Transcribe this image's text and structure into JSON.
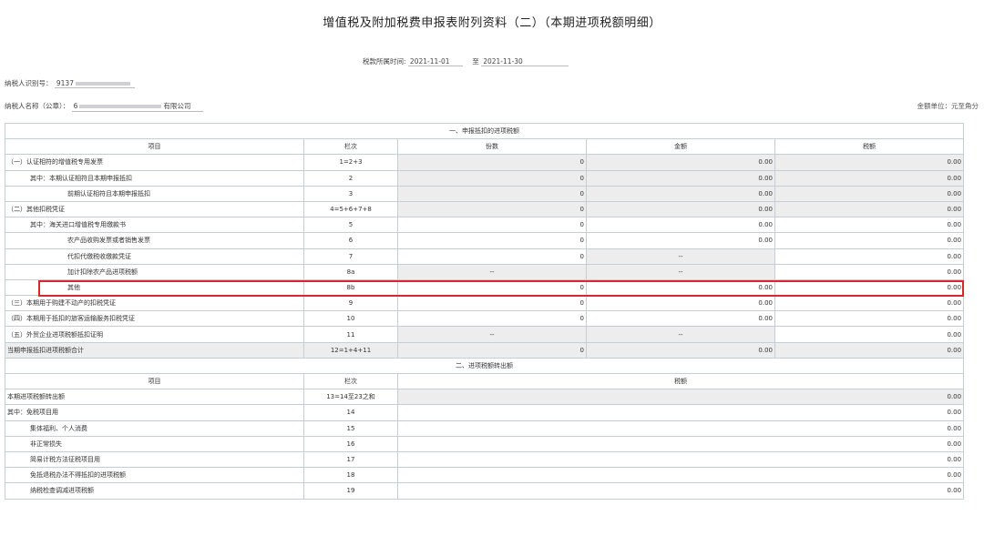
{
  "title": "增值税及附加税费申报表附列资料（二）（本期进项税额明细）",
  "period": {
    "label": "税款所属时间:",
    "start": "2021-11-01",
    "to": "至",
    "end": "2021-11-30"
  },
  "taxpayer_id": {
    "label": "纳税人识别号：",
    "value": "9137"
  },
  "taxpayer_name": {
    "label": "纳税人名称（公章）：",
    "prefix": "6",
    "suffix": "有限公司"
  },
  "amount_unit": "金额单位：元至角分",
  "section1": {
    "title": "一、申报抵扣的进项税额",
    "headers": [
      "项目",
      "栏次",
      "份数",
      "金额",
      "税额"
    ],
    "rows": [
      [
        "（一）认证相符的增值税专用发票",
        "1=2+3",
        "0",
        "0.00",
        "0.00"
      ],
      [
        "其中：本期认证相符且本期申报抵扣",
        "2",
        "0",
        "0.00",
        "0.00"
      ],
      [
        "前期认证相符且本期申报抵扣",
        "3",
        "0",
        "0.00",
        "0.00"
      ],
      [
        "（二）其他扣税凭证",
        "4=5+6+7+8",
        "0",
        "0.00",
        "0.00"
      ],
      [
        "其中：海关进口增值税专用缴款书",
        "5",
        "0",
        "0.00",
        "0.00"
      ],
      [
        "农产品收购发票或者销售发票",
        "6",
        "0",
        "0.00",
        "0.00"
      ],
      [
        "代扣代缴税收缴款凭证",
        "7",
        "0",
        "--",
        "0.00"
      ],
      [
        "加计扣除农产品进项税额",
        "8a",
        "--",
        "--",
        "0.00"
      ],
      [
        "其他",
        "8b",
        "0",
        "0.00",
        "0.00"
      ],
      [
        "（三）本期用于购建不动产的扣税凭证",
        "9",
        "0",
        "0.00",
        "0.00"
      ],
      [
        "（四）本期用于抵扣的旅客运输服务扣税凭证",
        "10",
        "0",
        "0.00",
        "0.00"
      ],
      [
        "（五）外贸企业进项税额抵扣证明",
        "11",
        "--",
        "--",
        "0.00"
      ],
      [
        "当期申报抵扣进项税额合计",
        "12=1+4+11",
        "0",
        "0.00",
        "0.00"
      ]
    ]
  },
  "section2": {
    "title": "二、进项税额转出额",
    "headers": [
      "项目",
      "栏次",
      "税额"
    ],
    "rows": [
      [
        "本期进项税额转出额",
        "13=14至23之和",
        "0.00"
      ],
      [
        "其中：免税项目用",
        "14",
        "0.00"
      ],
      [
        "集体福利、个人消费",
        "15",
        "0.00"
      ],
      [
        "非正常损失",
        "16",
        "0.00"
      ],
      [
        "简易计税方法征税项目用",
        "17",
        "0.00"
      ],
      [
        "免抵退税办法不得抵扣的进项税额",
        "18",
        "0.00"
      ],
      [
        "纳税检查调减进项税额",
        "19",
        "0.00"
      ]
    ]
  },
  "colors": {
    "highlight_border": "#d7282c",
    "readonly_cell": "#eeedee",
    "grid_line": "#c7cdd4"
  }
}
